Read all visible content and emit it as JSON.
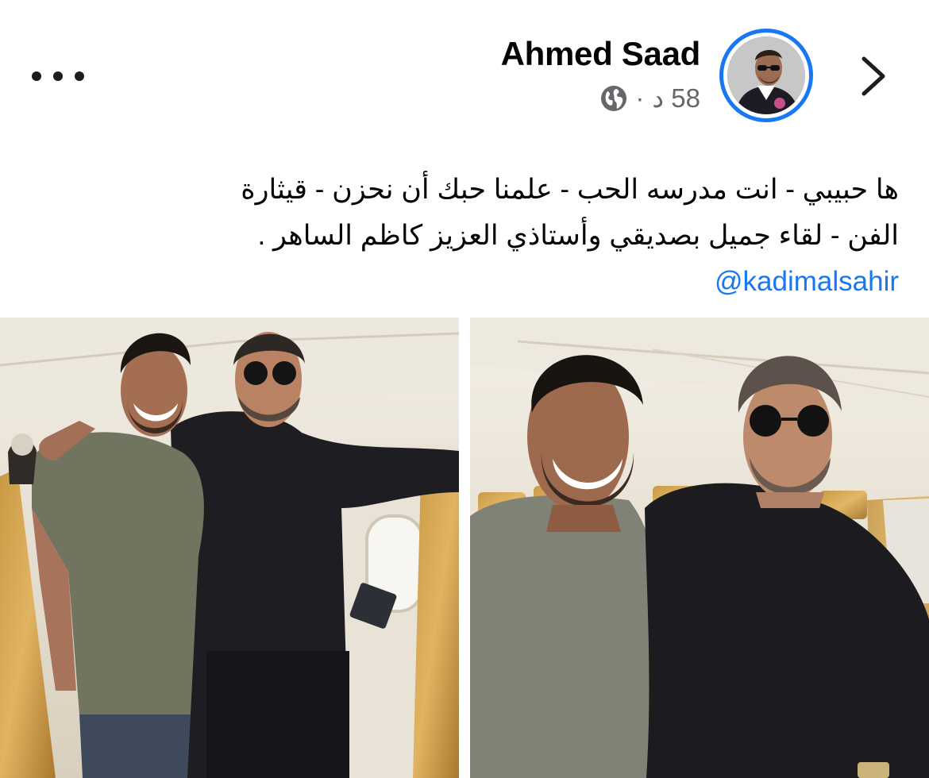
{
  "post": {
    "author": "Ahmed Saad",
    "time": "58 د",
    "separator": "·",
    "text_lines": [
      "ها حبيبي - انت مدرسه الحب - علمنا  حبك أن نحزن  - قيثارة",
      "الفن - لقاء جميل بصديقي وأستاذي العزيز كاظم الساهر ."
    ],
    "mention": "@kadimalsahir",
    "icons": {
      "more": "more-horizontal-icon",
      "privacy": "globe-icon",
      "back": "chevron-right-icon"
    },
    "colors": {
      "accent": "#1877f2",
      "secondary_text": "#65676b",
      "text": "#050505"
    },
    "photos": [
      {
        "label": "photo-left"
      },
      {
        "label": "photo-right"
      }
    ]
  }
}
